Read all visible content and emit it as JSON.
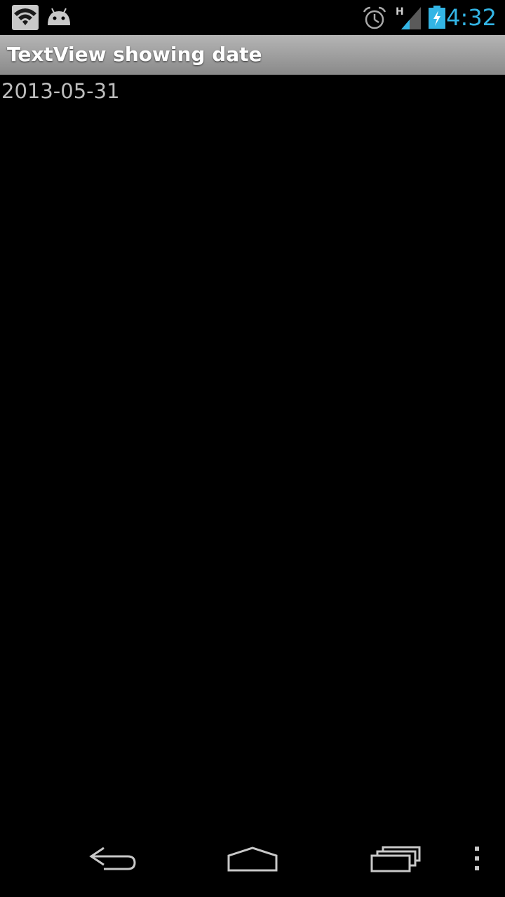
{
  "status_bar": {
    "time": "4:32",
    "network_type": "H",
    "icons": [
      "wifi-icon",
      "android-icon",
      "alarm-icon",
      "signal-icon",
      "battery-charging-icon"
    ],
    "clock_color": "#33b5e5"
  },
  "title_bar": {
    "title": "TextView showing date"
  },
  "content": {
    "date": "2013-05-31"
  },
  "nav_bar": {
    "buttons": [
      "back-icon",
      "home-icon",
      "recents-icon",
      "menu-icon"
    ]
  }
}
